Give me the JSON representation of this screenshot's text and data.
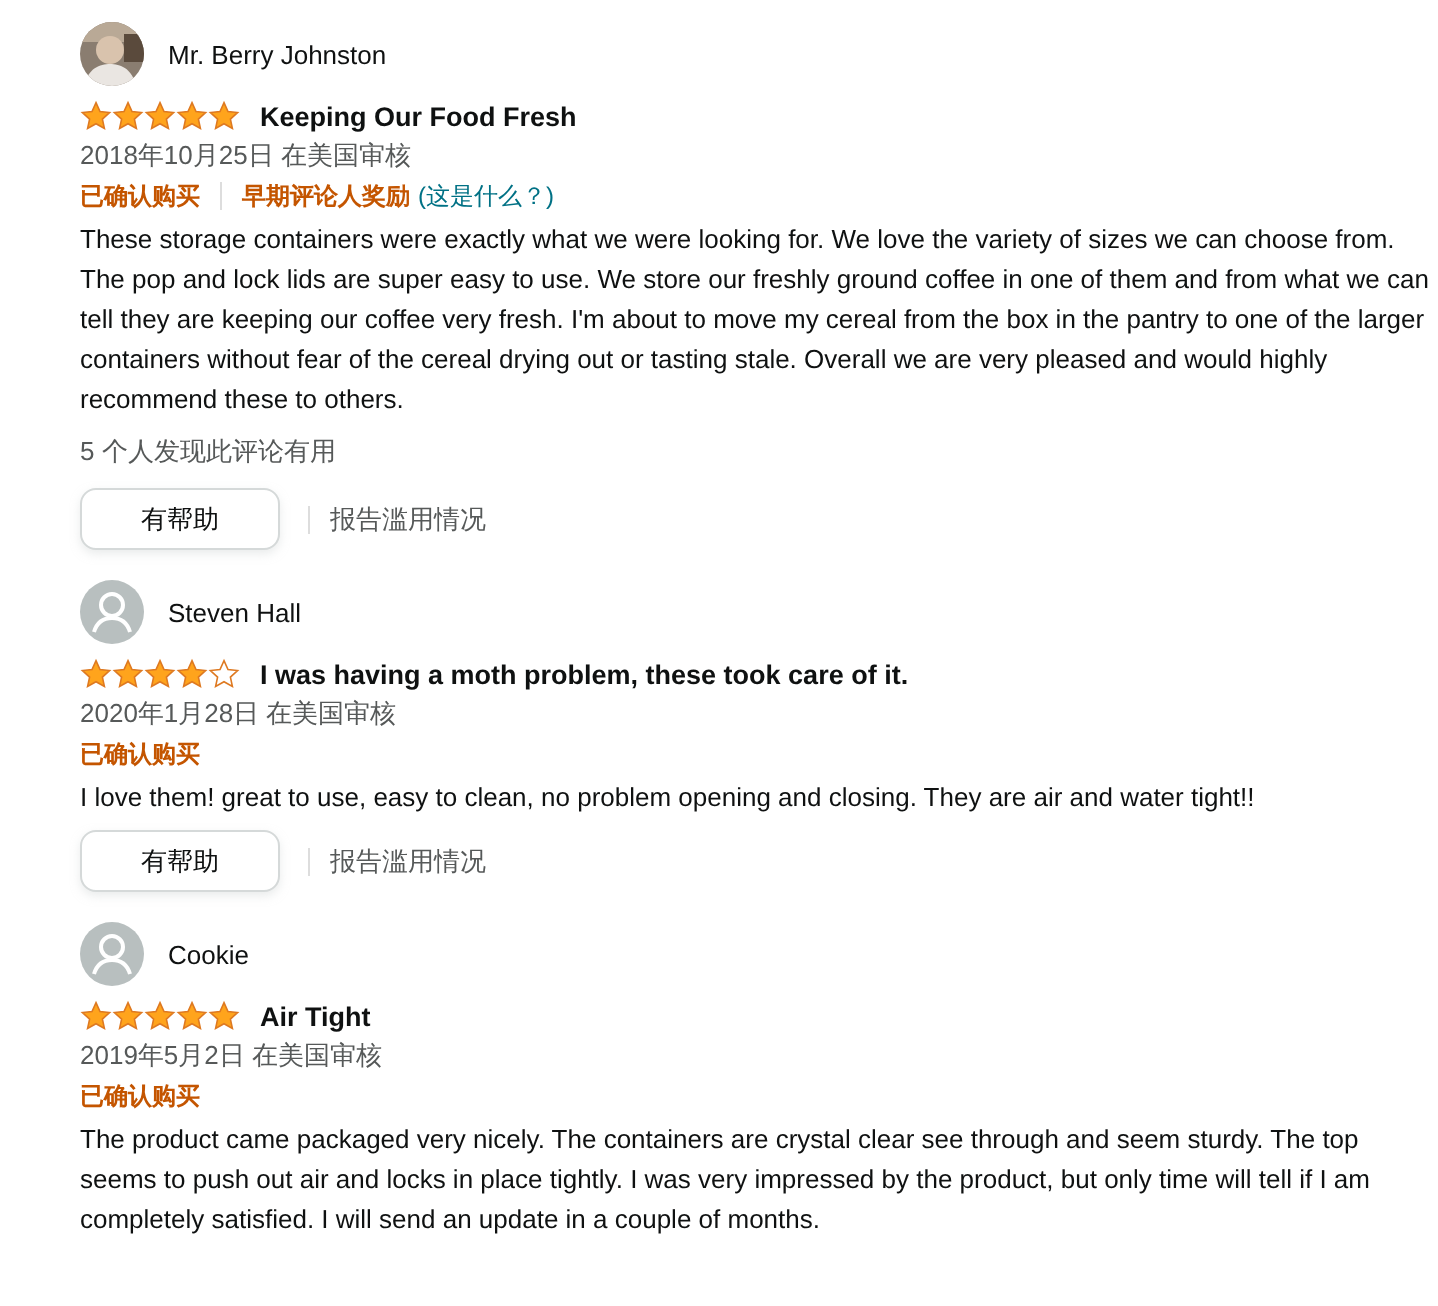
{
  "reviews": [
    {
      "author": "Mr. Berry Johnston",
      "avatar": {
        "kind": "picture"
      },
      "stars": 5,
      "title": "Keeping Our Food Fresh",
      "date": "2018年10月25日 在美国审核",
      "badges": [
        {
          "text": "已确认购买"
        },
        {
          "text": "早期评论人奖励",
          "link": "(这是什么？)"
        }
      ],
      "body": "These storage containers were exactly what we were looking for. We love the variety of sizes we can choose from. The pop and lock lids are super easy to use. We store our freshly ground coffee in one of them and from what we can tell they are keeping our coffee very fresh. I'm about to move my cereal from the box in the pantry to one of the larger containers without fear of the cereal drying out or tasting stale. Overall we are very pleased and would highly recommend these to others.",
      "helpful_count": "5 个人发现此评论有用",
      "helpful_button": "有帮助",
      "report_link": "报告滥用情况"
    },
    {
      "author": "Steven Hall",
      "avatar": {
        "kind": "silhouette"
      },
      "stars": 4,
      "title": "I was having a moth problem, these took care of it.",
      "date": "2020年1月28日 在美国审核",
      "badges": [
        {
          "text": "已确认购买"
        }
      ],
      "body": "I love them! great to use, easy to clean, no problem opening and closing. They are air and water tight!!",
      "helpful_button": "有帮助",
      "report_link": "报告滥用情况"
    },
    {
      "author": "Cookie",
      "avatar": {
        "kind": "silhouette"
      },
      "stars": 5,
      "title": "Air Tight",
      "date": "2019年5月2日 在美国审核",
      "badges": [
        {
          "text": "已确认购买"
        }
      ],
      "body": "The product came packaged very nicely. The containers are crystal clear see through and seem sturdy. The top seems to push out air and locks in place tightly. I was very impressed by the product, but only time will tell if I am completely satisfied. I will send an update in a couple of months."
    }
  ]
}
